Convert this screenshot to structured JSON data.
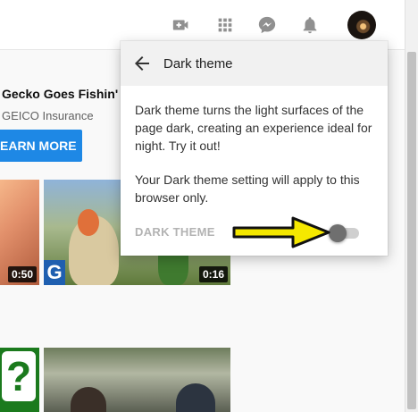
{
  "topbar": {
    "icons": [
      "create-video-icon",
      "apps-grid-icon",
      "messages-icon",
      "notifications-bell-icon"
    ],
    "avatar": "avatar"
  },
  "ad": {
    "title": "Gecko Goes Fishin'",
    "advertiser": "GEICO Insurance",
    "cta_label": "EARN MORE"
  },
  "videos": [
    {
      "duration": "0:50"
    },
    {
      "duration": "0:16"
    }
  ],
  "popup": {
    "title": "Dark theme",
    "description": "Dark theme turns the light surfaces of the page dark, creating an experience ideal for night. Try it out!",
    "note": "Your Dark theme setting will apply to this browser only.",
    "toggle_label": "DARK THEME",
    "toggle_on": false
  },
  "colors": {
    "cta": "#1e88e5",
    "annotation_arrow": "#f5e800"
  }
}
